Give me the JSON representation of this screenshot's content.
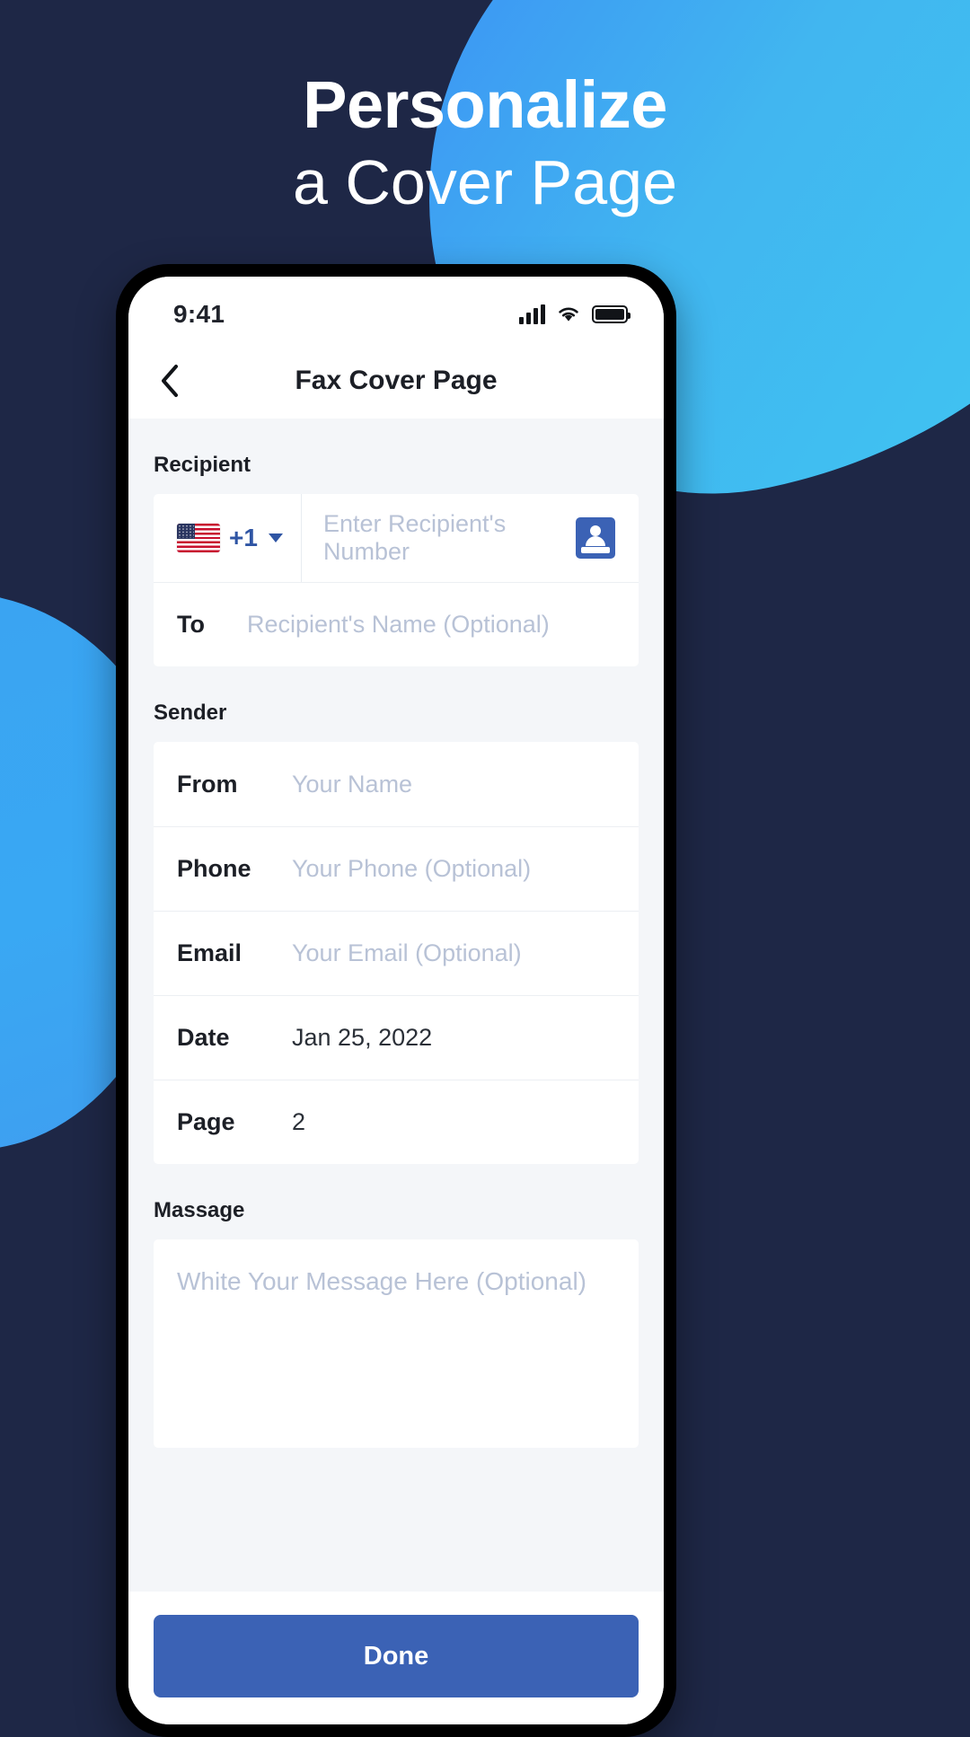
{
  "promo": {
    "headline_line1": "Personalize",
    "headline_line2": "a Cover Page",
    "background_color": "#1e2746",
    "accent_color": "#3fa8f2"
  },
  "status_bar": {
    "time": "9:41",
    "signal_icon": "cellular-signal-icon",
    "wifi_icon": "wifi-icon",
    "battery_icon": "battery-full-icon"
  },
  "nav": {
    "back_icon": "chevron-left-icon",
    "title": "Fax Cover Page"
  },
  "recipient": {
    "section_label": "Recipient",
    "country_flag": "us-flag-icon",
    "country_code": "+1",
    "dropdown_icon": "chevron-down-icon",
    "number_placeholder": "Enter Recipient's Number",
    "contacts_icon": "address-book-icon",
    "to_label": "To",
    "to_placeholder": "Recipient's Name (Optional)"
  },
  "sender": {
    "section_label": "Sender",
    "rows": [
      {
        "label": "From",
        "placeholder": "Your Name",
        "value": ""
      },
      {
        "label": "Phone",
        "placeholder": "Your Phone (Optional)",
        "value": ""
      },
      {
        "label": "Email",
        "placeholder": "Your Email (Optional)",
        "value": ""
      },
      {
        "label": "Date",
        "placeholder": "",
        "value": "Jan 25, 2022"
      },
      {
        "label": "Page",
        "placeholder": "",
        "value": "2"
      }
    ]
  },
  "message": {
    "section_label": "Massage",
    "placeholder": "White Your Message Here (Optional)"
  },
  "footer": {
    "done_label": "Done",
    "done_color": "#3b62b5"
  }
}
